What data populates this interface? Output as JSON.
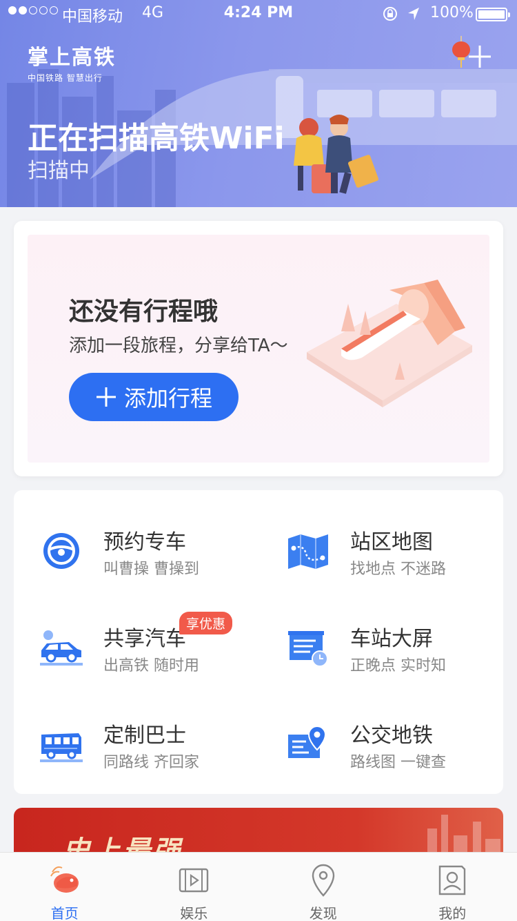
{
  "status_bar": {
    "carrier": "中国移动",
    "network": "4G",
    "time": "4:24 PM",
    "battery": "100%"
  },
  "header": {
    "brand_name": "掌上高铁",
    "brand_sub": "中国铁路 智慧出行",
    "title": "正在扫描高铁WiFi",
    "subtitle": "扫描中"
  },
  "trip": {
    "title": "还没有行程哦",
    "desc": "添加一段旅程，分享给TA～",
    "add_label": "添加行程"
  },
  "services": [
    {
      "title": "预约专车",
      "desc": "叫曹操 曹操到",
      "icon": "steering-wheel-icon"
    },
    {
      "title": "站区地图",
      "desc": "找地点 不迷路",
      "icon": "map-icon"
    },
    {
      "title": "共享汽车",
      "desc": "出高铁 随时用",
      "icon": "car-icon",
      "badge": "享优惠"
    },
    {
      "title": "车站大屏",
      "desc": "正晚点 实时知",
      "icon": "departure-board-icon"
    },
    {
      "title": "定制巴士",
      "desc": "同路线 齐回家",
      "icon": "bus-icon"
    },
    {
      "title": "公交地铁",
      "desc": "路线图 一键查",
      "icon": "transit-map-pin-icon"
    }
  ],
  "promo": {
    "text": "史上最强"
  },
  "tabbar": {
    "items": [
      {
        "label": "首页",
        "icon": "home-icon",
        "active": true
      },
      {
        "label": "娱乐",
        "icon": "video-icon",
        "active": false
      },
      {
        "label": "发现",
        "icon": "location-icon",
        "active": false
      },
      {
        "label": "我的",
        "icon": "profile-icon",
        "active": false
      }
    ]
  },
  "colors": {
    "accent": "#2d6ff2",
    "badge": "#f15a4a",
    "promo": "#c8261e"
  }
}
